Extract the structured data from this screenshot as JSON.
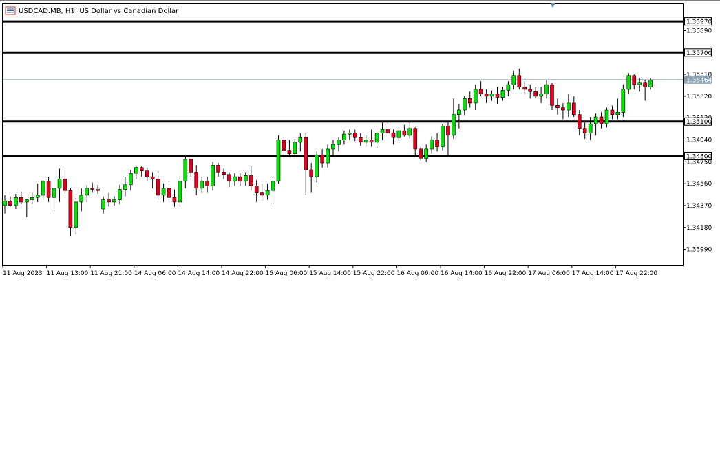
{
  "window": {
    "title": "USDCAD.MB, H1:  US Dollar vs Canadian Dollar",
    "icon": "chart-window-icon"
  },
  "colors": {
    "bull": "#00e600",
    "bear": "#e6001e",
    "wick": "#000000",
    "bid_line": "#8ea3b3",
    "bid_label_bg": "#8ea3b3",
    "level_line": "#000000",
    "frame": "#000000",
    "label_bg": "#000000",
    "label_fg": "#ffffff",
    "marker": "#6a8fb8"
  },
  "chart_data": {
    "type": "candlestick",
    "symbol": "USDCAD.MB",
    "timeframe": "H1",
    "ylim": [
      1.3385,
      1.3612
    ],
    "y_ticks": [
      "1.33990",
      "1.34180",
      "1.34370",
      "1.34560",
      "1.34750",
      "1.34940",
      "1.35130",
      "1.35320",
      "1.35510",
      "1.35890"
    ],
    "x_ticks": [
      "11 Aug 2023",
      "11 Aug 13:00",
      "11 Aug 21:00",
      "14 Aug 06:00",
      "14 Aug 14:00",
      "14 Aug 22:00",
      "15 Aug 06:00",
      "15 Aug 14:00",
      "15 Aug 22:00",
      "16 Aug 06:00",
      "16 Aug 14:00",
      "16 Aug 22:00",
      "17 Aug 06:00",
      "17 Aug 14:00",
      "17 Aug 22:00"
    ],
    "x_tick_candle_index": [
      0,
      8,
      16,
      24,
      32,
      40,
      48,
      56,
      64,
      72,
      80,
      88,
      96,
      104,
      112
    ],
    "horizontal_levels": [
      {
        "label": "1.35970",
        "value": 1.3597
      },
      {
        "label": "1.35700",
        "value": 1.357
      },
      {
        "label": "1.35100",
        "value": 1.351
      },
      {
        "label": "1.34800",
        "value": 1.348
      }
    ],
    "bid": {
      "label": "1.35464",
      "value": 1.35464
    },
    "candles": [
      {
        "o": 1.3437,
        "h": 1.3446,
        "l": 1.343,
        "c": 1.3441
      },
      {
        "o": 1.3441,
        "h": 1.3445,
        "l": 1.3436,
        "c": 1.3437
      },
      {
        "o": 1.3437,
        "h": 1.3447,
        "l": 1.3434,
        "c": 1.3444
      },
      {
        "o": 1.3444,
        "h": 1.3449,
        "l": 1.3438,
        "c": 1.344
      },
      {
        "o": 1.344,
        "h": 1.3443,
        "l": 1.3427,
        "c": 1.3442
      },
      {
        "o": 1.3442,
        "h": 1.3448,
        "l": 1.3438,
        "c": 1.3444
      },
      {
        "o": 1.3444,
        "h": 1.3456,
        "l": 1.344,
        "c": 1.3446
      },
      {
        "o": 1.3446,
        "h": 1.3459,
        "l": 1.3442,
        "c": 1.3458
      },
      {
        "o": 1.3458,
        "h": 1.3462,
        "l": 1.344,
        "c": 1.3444
      },
      {
        "o": 1.3444,
        "h": 1.3458,
        "l": 1.3432,
        "c": 1.3452
      },
      {
        "o": 1.3452,
        "h": 1.3469,
        "l": 1.344,
        "c": 1.346
      },
      {
        "o": 1.346,
        "h": 1.347,
        "l": 1.3445,
        "c": 1.345
      },
      {
        "o": 1.345,
        "h": 1.3452,
        "l": 1.341,
        "c": 1.3418
      },
      {
        "o": 1.3418,
        "h": 1.3445,
        "l": 1.3412,
        "c": 1.344
      },
      {
        "o": 1.344,
        "h": 1.3452,
        "l": 1.3432,
        "c": 1.3446
      },
      {
        "o": 1.3446,
        "h": 1.3455,
        "l": 1.344,
        "c": 1.3452
      },
      {
        "o": 1.3452,
        "h": 1.3457,
        "l": 1.3448,
        "c": 1.3451
      },
      {
        "o": 1.3451,
        "h": 1.3455,
        "l": 1.3447,
        "c": 1.345
      },
      {
        "o": 1.3434,
        "h": 1.3445,
        "l": 1.343,
        "c": 1.3442
      },
      {
        "o": 1.3442,
        "h": 1.3448,
        "l": 1.3436,
        "c": 1.344
      },
      {
        "o": 1.344,
        "h": 1.3445,
        "l": 1.3437,
        "c": 1.3442
      },
      {
        "o": 1.3442,
        "h": 1.3455,
        "l": 1.3438,
        "c": 1.3451
      },
      {
        "o": 1.3451,
        "h": 1.3462,
        "l": 1.3445,
        "c": 1.3455
      },
      {
        "o": 1.3455,
        "h": 1.3468,
        "l": 1.345,
        "c": 1.3465
      },
      {
        "o": 1.3465,
        "h": 1.3472,
        "l": 1.346,
        "c": 1.347
      },
      {
        "o": 1.347,
        "h": 1.3471,
        "l": 1.3462,
        "c": 1.3467
      },
      {
        "o": 1.3467,
        "h": 1.347,
        "l": 1.3458,
        "c": 1.3462
      },
      {
        "o": 1.3462,
        "h": 1.3466,
        "l": 1.3452,
        "c": 1.346
      },
      {
        "o": 1.346,
        "h": 1.3467,
        "l": 1.3442,
        "c": 1.3446
      },
      {
        "o": 1.3446,
        "h": 1.3456,
        "l": 1.344,
        "c": 1.3452
      },
      {
        "o": 1.3452,
        "h": 1.3456,
        "l": 1.3442,
        "c": 1.3444
      },
      {
        "o": 1.3444,
        "h": 1.3451,
        "l": 1.3436,
        "c": 1.344
      },
      {
        "o": 1.344,
        "h": 1.3462,
        "l": 1.3436,
        "c": 1.3458
      },
      {
        "o": 1.3458,
        "h": 1.348,
        "l": 1.3452,
        "c": 1.3477
      },
      {
        "o": 1.3477,
        "h": 1.3478,
        "l": 1.3462,
        "c": 1.3466
      },
      {
        "o": 1.3466,
        "h": 1.3472,
        "l": 1.3446,
        "c": 1.3452
      },
      {
        "o": 1.3452,
        "h": 1.3462,
        "l": 1.3448,
        "c": 1.3458
      },
      {
        "o": 1.3458,
        "h": 1.3462,
        "l": 1.3448,
        "c": 1.3454
      },
      {
        "o": 1.3454,
        "h": 1.3475,
        "l": 1.345,
        "c": 1.3472
      },
      {
        "o": 1.3472,
        "h": 1.3474,
        "l": 1.3462,
        "c": 1.3466
      },
      {
        "o": 1.3466,
        "h": 1.3469,
        "l": 1.346,
        "c": 1.3464
      },
      {
        "o": 1.3464,
        "h": 1.3466,
        "l": 1.3453,
        "c": 1.3458
      },
      {
        "o": 1.3458,
        "h": 1.3465,
        "l": 1.3454,
        "c": 1.3462
      },
      {
        "o": 1.3462,
        "h": 1.3465,
        "l": 1.3454,
        "c": 1.3458
      },
      {
        "o": 1.3458,
        "h": 1.3466,
        "l": 1.3454,
        "c": 1.3463
      },
      {
        "o": 1.3463,
        "h": 1.3471,
        "l": 1.345,
        "c": 1.3454
      },
      {
        "o": 1.3454,
        "h": 1.3459,
        "l": 1.344,
        "c": 1.3448
      },
      {
        "o": 1.3448,
        "h": 1.3456,
        "l": 1.3441,
        "c": 1.3446
      },
      {
        "o": 1.3446,
        "h": 1.3456,
        "l": 1.3442,
        "c": 1.345
      },
      {
        "o": 1.345,
        "h": 1.346,
        "l": 1.3438,
        "c": 1.3458
      },
      {
        "o": 1.3458,
        "h": 1.3498,
        "l": 1.3456,
        "c": 1.3494
      },
      {
        "o": 1.3494,
        "h": 1.3496,
        "l": 1.3478,
        "c": 1.3485
      },
      {
        "o": 1.3485,
        "h": 1.3494,
        "l": 1.3479,
        "c": 1.3482
      },
      {
        "o": 1.3482,
        "h": 1.3495,
        "l": 1.3478,
        "c": 1.3492
      },
      {
        "o": 1.3492,
        "h": 1.35,
        "l": 1.3484,
        "c": 1.3496
      },
      {
        "o": 1.3496,
        "h": 1.35,
        "l": 1.3446,
        "c": 1.3468
      },
      {
        "o": 1.3468,
        "h": 1.3474,
        "l": 1.3448,
        "c": 1.3462
      },
      {
        "o": 1.3462,
        "h": 1.3484,
        "l": 1.3457,
        "c": 1.3481
      },
      {
        "o": 1.3481,
        "h": 1.3486,
        "l": 1.347,
        "c": 1.3474
      },
      {
        "o": 1.3474,
        "h": 1.349,
        "l": 1.347,
        "c": 1.3486
      },
      {
        "o": 1.3486,
        "h": 1.3494,
        "l": 1.348,
        "c": 1.349
      },
      {
        "o": 1.349,
        "h": 1.3496,
        "l": 1.3484,
        "c": 1.3494
      },
      {
        "o": 1.3494,
        "h": 1.3502,
        "l": 1.349,
        "c": 1.3499
      },
      {
        "o": 1.3499,
        "h": 1.3503,
        "l": 1.3494,
        "c": 1.35
      },
      {
        "o": 1.35,
        "h": 1.3503,
        "l": 1.3493,
        "c": 1.3496
      },
      {
        "o": 1.3496,
        "h": 1.35,
        "l": 1.3489,
        "c": 1.3492
      },
      {
        "o": 1.3492,
        "h": 1.3498,
        "l": 1.3488,
        "c": 1.3494
      },
      {
        "o": 1.3494,
        "h": 1.3503,
        "l": 1.3488,
        "c": 1.3492
      },
      {
        "o": 1.3492,
        "h": 1.3502,
        "l": 1.3487,
        "c": 1.35
      },
      {
        "o": 1.35,
        "h": 1.351,
        "l": 1.3494,
        "c": 1.3503
      },
      {
        "o": 1.3503,
        "h": 1.3506,
        "l": 1.3496,
        "c": 1.35
      },
      {
        "o": 1.35,
        "h": 1.3503,
        "l": 1.349,
        "c": 1.3496
      },
      {
        "o": 1.3496,
        "h": 1.3505,
        "l": 1.3493,
        "c": 1.3502
      },
      {
        "o": 1.3502,
        "h": 1.3507,
        "l": 1.3497,
        "c": 1.3498
      },
      {
        "o": 1.3498,
        "h": 1.351,
        "l": 1.3495,
        "c": 1.3504
      },
      {
        "o": 1.3504,
        "h": 1.3505,
        "l": 1.348,
        "c": 1.3486
      },
      {
        "o": 1.3486,
        "h": 1.3488,
        "l": 1.3476,
        "c": 1.3478
      },
      {
        "o": 1.3478,
        "h": 1.349,
        "l": 1.3475,
        "c": 1.3486
      },
      {
        "o": 1.3486,
        "h": 1.3497,
        "l": 1.3482,
        "c": 1.3494
      },
      {
        "o": 1.3494,
        "h": 1.35,
        "l": 1.3484,
        "c": 1.3488
      },
      {
        "o": 1.3488,
        "h": 1.3508,
        "l": 1.3485,
        "c": 1.3506
      },
      {
        "o": 1.3506,
        "h": 1.351,
        "l": 1.348,
        "c": 1.3498
      },
      {
        "o": 1.3498,
        "h": 1.353,
        "l": 1.3495,
        "c": 1.3516
      },
      {
        "o": 1.3516,
        "h": 1.3525,
        "l": 1.3504,
        "c": 1.352
      },
      {
        "o": 1.352,
        "h": 1.3532,
        "l": 1.3515,
        "c": 1.353
      },
      {
        "o": 1.353,
        "h": 1.3536,
        "l": 1.3522,
        "c": 1.3526
      },
      {
        "o": 1.3526,
        "h": 1.3542,
        "l": 1.352,
        "c": 1.3538
      },
      {
        "o": 1.3538,
        "h": 1.3545,
        "l": 1.3532,
        "c": 1.3534
      },
      {
        "o": 1.3534,
        "h": 1.3538,
        "l": 1.3526,
        "c": 1.3532
      },
      {
        "o": 1.3532,
        "h": 1.3537,
        "l": 1.3528,
        "c": 1.3534
      },
      {
        "o": 1.3534,
        "h": 1.354,
        "l": 1.3525,
        "c": 1.3531
      },
      {
        "o": 1.3531,
        "h": 1.354,
        "l": 1.3528,
        "c": 1.3537
      },
      {
        "o": 1.3537,
        "h": 1.3545,
        "l": 1.3532,
        "c": 1.3542
      },
      {
        "o": 1.3542,
        "h": 1.3554,
        "l": 1.3538,
        "c": 1.355
      },
      {
        "o": 1.355,
        "h": 1.3556,
        "l": 1.3538,
        "c": 1.354
      },
      {
        "o": 1.354,
        "h": 1.3545,
        "l": 1.3534,
        "c": 1.3538
      },
      {
        "o": 1.3538,
        "h": 1.3542,
        "l": 1.353,
        "c": 1.3536
      },
      {
        "o": 1.3536,
        "h": 1.354,
        "l": 1.353,
        "c": 1.3532
      },
      {
        "o": 1.3532,
        "h": 1.354,
        "l": 1.3526,
        "c": 1.3534
      },
      {
        "o": 1.3534,
        "h": 1.3546,
        "l": 1.353,
        "c": 1.3542
      },
      {
        "o": 1.3542,
        "h": 1.3544,
        "l": 1.352,
        "c": 1.3524
      },
      {
        "o": 1.3524,
        "h": 1.353,
        "l": 1.3516,
        "c": 1.3522
      },
      {
        "o": 1.3522,
        "h": 1.3526,
        "l": 1.3512,
        "c": 1.352
      },
      {
        "o": 1.352,
        "h": 1.3534,
        "l": 1.3514,
        "c": 1.3526
      },
      {
        "o": 1.3526,
        "h": 1.3532,
        "l": 1.3514,
        "c": 1.3516
      },
      {
        "o": 1.3516,
        "h": 1.352,
        "l": 1.3498,
        "c": 1.3504
      },
      {
        "o": 1.3504,
        "h": 1.351,
        "l": 1.3495,
        "c": 1.35
      },
      {
        "o": 1.35,
        "h": 1.3514,
        "l": 1.3494,
        "c": 1.3508
      },
      {
        "o": 1.3508,
        "h": 1.3517,
        "l": 1.3498,
        "c": 1.3514
      },
      {
        "o": 1.3514,
        "h": 1.3518,
        "l": 1.3504,
        "c": 1.3508
      },
      {
        "o": 1.3508,
        "h": 1.3522,
        "l": 1.3505,
        "c": 1.352
      },
      {
        "o": 1.352,
        "h": 1.3524,
        "l": 1.3512,
        "c": 1.3516
      },
      {
        "o": 1.3516,
        "h": 1.353,
        "l": 1.3512,
        "c": 1.3518
      },
      {
        "o": 1.3518,
        "h": 1.3542,
        "l": 1.3514,
        "c": 1.3538
      },
      {
        "o": 1.3538,
        "h": 1.3552,
        "l": 1.3534,
        "c": 1.355
      },
      {
        "o": 1.355,
        "h": 1.3551,
        "l": 1.3538,
        "c": 1.3542
      },
      {
        "o": 1.3542,
        "h": 1.3548,
        "l": 1.3536,
        "c": 1.3544
      },
      {
        "o": 1.3544,
        "h": 1.3546,
        "l": 1.3528,
        "c": 1.354
      },
      {
        "o": 1.354,
        "h": 1.3548,
        "l": 1.3538,
        "c": 1.3546
      }
    ]
  }
}
